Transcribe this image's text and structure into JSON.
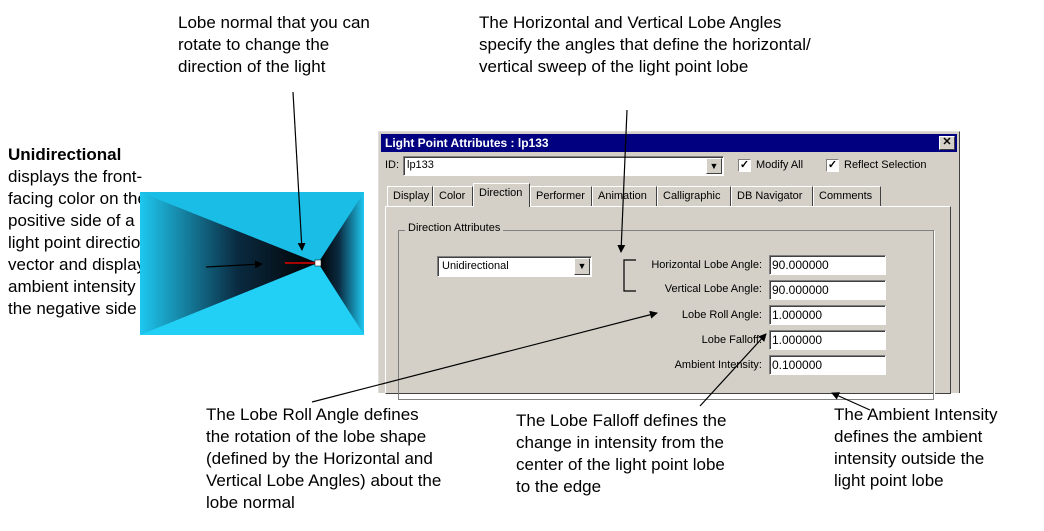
{
  "callouts": {
    "lobe_normal": [
      "Lobe normal that you can",
      "rotate to change the",
      "direction of the light"
    ],
    "lobe_angles": [
      "The Horizontal and Vertical Lobe Angles",
      "specify the angles that define the horizontal/",
      "vertical sweep of the light point lobe"
    ],
    "unidirectional_title": "Unidirectional",
    "unidirectional_body": [
      "displays the front-",
      "facing color on the",
      "positive side of a",
      "light point direction",
      "vector and displays",
      "ambient intensity on",
      "the negative side"
    ],
    "roll_angle": [
      "The Lobe Roll Angle defines",
      "the rotation of the lobe shape",
      "(defined by the Horizontal and",
      "Vertical Lobe Angles) about the",
      "lobe normal"
    ],
    "falloff": [
      "The Lobe Falloff defines the",
      "change in intensity from the",
      "center of the light point lobe",
      "to the edge"
    ],
    "ambient": [
      "The Ambient Intensity",
      "defines the ambient",
      "intensity outside the",
      "light point lobe"
    ]
  },
  "dialog": {
    "title": "Light Point Attributes : lp133",
    "id_label": "ID:",
    "id_value": "lp133",
    "modify_all_label": "Modify All",
    "modify_all_checked": true,
    "reflect_selection_label": "Reflect Selection",
    "reflect_selection_checked": true,
    "tabs": [
      "Display",
      "Color",
      "Direction",
      "Performer",
      "Animation",
      "Calligraphic",
      "DB Navigator",
      "Comments"
    ],
    "active_tab": "Direction",
    "group_label": "Direction Attributes",
    "direction_type": "Unidirectional",
    "fields": [
      {
        "label": "Horizontal Lobe Angle:",
        "value": "90.000000"
      },
      {
        "label": "Vertical Lobe Angle:",
        "value": "90.000000"
      },
      {
        "label": "Lobe Roll Angle:",
        "value": "1.000000"
      },
      {
        "label": "Lobe Falloff:",
        "value": "1.000000"
      },
      {
        "label": "Ambient Intensity:",
        "value": "0.100000"
      }
    ]
  },
  "colors": {
    "cyan": "#1ec8f0",
    "titlebar": "#000080",
    "dialog_bg": "#d4d0c8"
  },
  "icons": {
    "close": "close-icon",
    "dropdown": "chevron-down-icon",
    "check": "check-icon"
  }
}
